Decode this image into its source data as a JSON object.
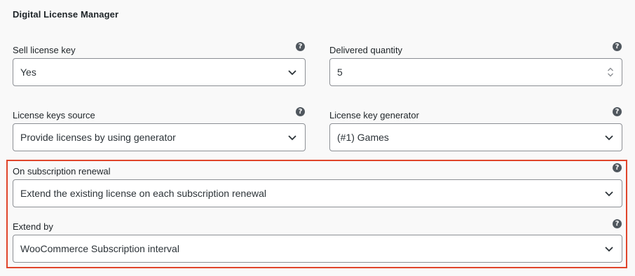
{
  "section": {
    "title": "Digital License Manager"
  },
  "fields": {
    "sell_license_key": {
      "label": "Sell license key",
      "value": "Yes"
    },
    "delivered_quantity": {
      "label": "Delivered quantity",
      "value": "5"
    },
    "license_keys_source": {
      "label": "License keys source",
      "value": "Provide licenses by using generator"
    },
    "license_key_generator": {
      "label": "License key generator",
      "value": "(#1) Games"
    },
    "on_subscription_renewal": {
      "label": "On subscription renewal",
      "value": "Extend the existing license on each subscription renewal"
    },
    "extend_by": {
      "label": "Extend by",
      "value": "WooCommerce Subscription interval"
    }
  },
  "help_icon_glyph": "?",
  "colors": {
    "background": "#f9f9f9",
    "highlight_border": "#e0452b",
    "control_border": "#8c8f94",
    "help_icon": "#50575e"
  },
  "icons": {
    "select_arrow": "chevron-down-icon",
    "number_spinner": "spinner-icon",
    "help": "help-icon"
  }
}
